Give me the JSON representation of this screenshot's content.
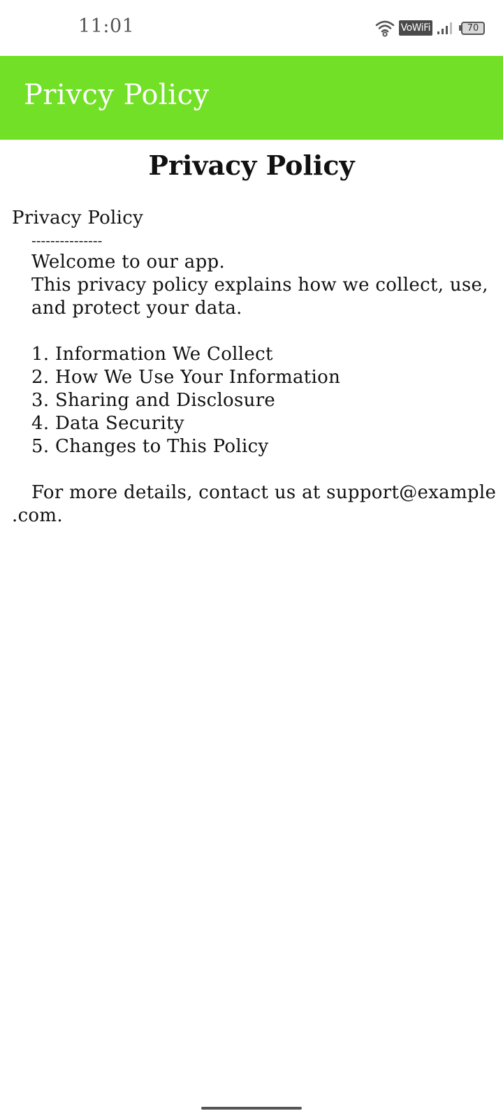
{
  "status_bar": {
    "time": "11:01",
    "network_badge": "VoWiFi",
    "battery_level": "70",
    "icons": [
      "wifi-icon",
      "signal-icon",
      "battery-icon"
    ]
  },
  "app_bar": {
    "title": "Privcy Policy",
    "background_color": "#72e026"
  },
  "page": {
    "heading": "Privacy Policy",
    "intro_title": "Privacy Policy",
    "divider": "---------------",
    "welcome": "Welcome to our app.",
    "description": "This privacy policy explains how we collect, use, and protect your data.",
    "sections": [
      "1. Information We Collect",
      "2. How We Use Your Information",
      "3. Sharing and Disclosure",
      "4. Data Security",
      "5. Changes to This Policy"
    ],
    "contact_line_1": "For more details, contact us at support@example",
    "contact_line_2": ".com."
  }
}
